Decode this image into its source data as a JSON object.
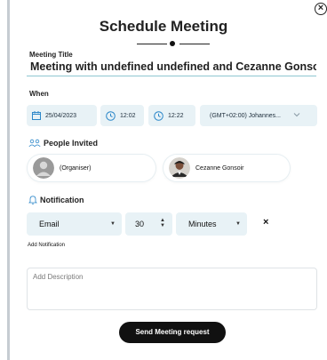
{
  "dialog": {
    "title": "Schedule Meeting"
  },
  "meeting_title": {
    "label": "Meeting Title",
    "value": "Meeting with undefined undefined and Cezanne  Gonsoir"
  },
  "when": {
    "label": "When",
    "date": "25/04/2023",
    "start_time": "12:02",
    "end_time": "12:22",
    "timezone": "(GMT+02:00) Johannes..."
  },
  "people": {
    "label": "People Invited",
    "organiser": "(Organiser)",
    "invitee": "Cezanne Gonsoir"
  },
  "notification": {
    "label": "Notification",
    "method": "Email",
    "amount": "30",
    "unit": "Minutes",
    "remove_label": "×",
    "add_label": "Add Notification"
  },
  "description": {
    "placeholder": "Add Description"
  },
  "actions": {
    "send_label": "Send Meeting request"
  },
  "colors": {
    "accent": "#8fc6d0",
    "field_bg": "#e8f2f6",
    "button_bg": "#111111"
  }
}
